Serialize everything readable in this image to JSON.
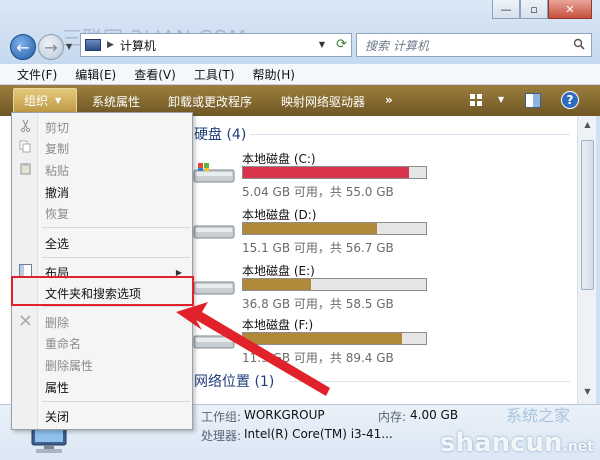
{
  "window": {
    "watermark_top": "三联网 3LIAN.COM",
    "minimize_icon": "minimize-icon",
    "maximize_icon": "maximize-icon",
    "close_icon": "close-icon"
  },
  "address": {
    "path": "计算机",
    "search_placeholder": "搜索 计算机"
  },
  "menubar": {
    "items": [
      "文件(F)",
      "编辑(E)",
      "查看(V)",
      "工具(T)",
      "帮助(H)"
    ]
  },
  "toolbar": {
    "organize": "组织",
    "items": [
      "系统属性",
      "卸载或更改程序",
      "映射网络驱动器"
    ],
    "more": "»",
    "help": "?"
  },
  "content": {
    "hard_disks_header": "硬盘 (4)",
    "network_header": "网络位置 (1)",
    "drives": [
      {
        "name": "本地磁盘 (C:)",
        "info": "5.04 GB 可用，共 55.0 GB",
        "used_fraction": 0.908,
        "bar_color": "#d8344c"
      },
      {
        "name": "本地磁盘 (D:)",
        "info": "15.1 GB 可用，共 56.7 GB",
        "used_fraction": 0.734,
        "bar_color": "#b08a3a"
      },
      {
        "name": "本地磁盘 (E:)",
        "info": "36.8 GB 可用，共 58.5 GB",
        "used_fraction": 0.371,
        "bar_color": "#b08a3a"
      },
      {
        "name": "本地磁盘 (F:)",
        "info": "11.9 GB 可用，共 89.4 GB",
        "used_fraction": 0.867,
        "bar_color": "#b08a3a"
      }
    ]
  },
  "details": {
    "workgroup_label": "工作组:",
    "workgroup_value": "WORKGROUP",
    "memory_label": "内存:",
    "memory_value": "4.00 GB",
    "processor_label": "处理器:",
    "processor_value": "Intel(R) Core(TM) i3-41..."
  },
  "dropdown": {
    "cut": "剪切",
    "copy": "复制",
    "paste": "粘贴",
    "undo": "撤消",
    "redo": "恢复",
    "select_all": "全选",
    "layout": "布局",
    "folder_options": "文件夹和搜索选项",
    "delete": "删除",
    "rename": "重命名",
    "remove_properties": "删除属性",
    "properties": "属性",
    "close": "关闭"
  },
  "watermark_br": {
    "main": "shancun",
    "suffix": ".net",
    "upper": "系统之家"
  },
  "colors": {
    "toolbar": "#8a6d30",
    "highlight": "#e2222a",
    "link": "#1f3f7a"
  }
}
